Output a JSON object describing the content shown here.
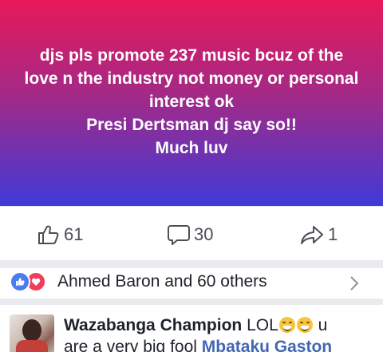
{
  "post": {
    "lines": [
      "djs pls  promote 237 music bcuz of the",
      "love n the industry not money or personal",
      "interest  ok",
      "Presi Dertsman dj say so!!",
      "Much luv"
    ],
    "background_colors": [
      "#e8185a",
      "#a02a88",
      "#3f3ad8"
    ]
  },
  "actions": {
    "like_count": "61",
    "comment_count": "30",
    "share_count": "1",
    "like_icon": "thumbs-up-icon",
    "comment_icon": "comment-bubble-icon",
    "share_icon": "share-arrow-icon"
  },
  "reactions": {
    "summary": "Ahmed Baron and 60 others",
    "icons": [
      "like-reaction-icon",
      "love-reaction-icon"
    ],
    "like_color": "#4a7cf0",
    "love_color": "#ef3d5a"
  },
  "comment": {
    "author": "Wazabanga Champion",
    "text_start": "LOL",
    "text_after_emoji": " u",
    "line2": "are a very big fool ",
    "mention": "Mbataku Gaston"
  }
}
